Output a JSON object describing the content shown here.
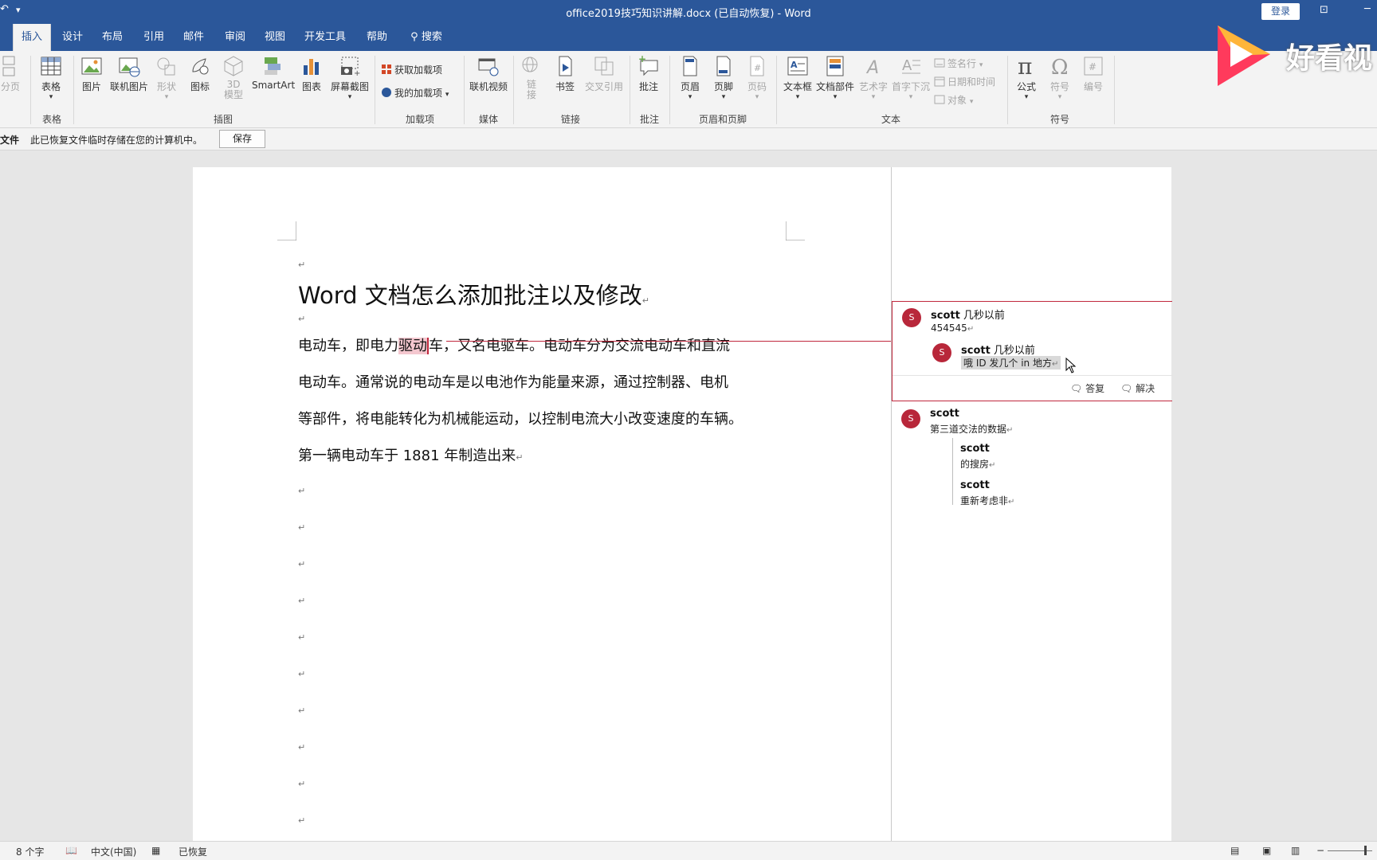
{
  "titlebar": {
    "title": "office2019技巧知识讲解.docx (已自动恢复)  -  Word",
    "login": "登录",
    "qa_icon": "undo-icon",
    "qa_dropdown": "▾"
  },
  "tabs": [
    "插入",
    "设计",
    "布局",
    "引用",
    "邮件",
    "审阅",
    "视图",
    "开发工具",
    "帮助",
    "搜索"
  ],
  "ribbon": {
    "page_break": "分页",
    "table": "表格",
    "picture": "图片",
    "online_picture": "联机图片",
    "shapes": "形状",
    "icons": "图标",
    "model3d": "3D\n模型",
    "smartart": "SmartArt",
    "chart": "图表",
    "screenshot": "屏幕截图",
    "get_addins": "获取加载项",
    "my_addins": "我的加载项",
    "online_video": "联机视频",
    "link": "链\n接",
    "bookmark": "书签",
    "cross_ref": "交叉引用",
    "comment": "批注",
    "header": "页眉",
    "footer": "页脚",
    "page_number": "页码",
    "textbox": "文本框",
    "quick_parts": "文档部件",
    "wordart": "艺术字",
    "drop_cap": "首字下沉",
    "signature": "签名行",
    "datetime": "日期和时间",
    "object": "对象",
    "equation": "公式",
    "symbol": "符号",
    "numbering": "编号",
    "groups": {
      "tables": "表格",
      "illustrations": "插图",
      "addins": "加载项",
      "media": "媒体",
      "links": "链接",
      "comments": "批注",
      "header_footer": "页眉和页脚",
      "text": "文本",
      "symbols": "符号"
    }
  },
  "infobar": {
    "label": "文件",
    "message": "此已恢复文件临时存储在您的计算机中。",
    "save": "保存"
  },
  "document": {
    "title": "Word 文档怎么添加批注以及修改",
    "line1_a": "电动车，即电力",
    "line1_hl": "驱动",
    "line1_b": "车，又名电驱车。电动车分为交流电动车和直流",
    "line2": "电动车。通常说的电动车是以电池作为能量来源，通过控制器、电机",
    "line3": "等部件，将电能转化为机械能运动，以控制电流大小改变速度的车辆。",
    "line4": "第一辆电动车于 1881 年制造出来",
    "pilcrow": "↵"
  },
  "comments": [
    {
      "author": "scott",
      "time": "几秒以前",
      "text": "454545",
      "avatar": "S",
      "replies": [
        {
          "author": "scott",
          "time": "几秒以前",
          "text": "哦 ID 发几个 in 地方",
          "avatar": "S"
        }
      ],
      "reply_label": "答复",
      "resolve_label": "解决"
    },
    {
      "author": "scott",
      "text": "第三道交法的数据",
      "avatar": "S",
      "replies": [
        {
          "author": "scott",
          "text": "的搜房"
        },
        {
          "author": "scott",
          "text": "重新考虑非"
        }
      ]
    }
  ],
  "statusbar": {
    "word_count": "8 个字",
    "language": "中文(中国)",
    "status": "已恢复"
  },
  "watermark": {
    "text": "好看视"
  },
  "colors": {
    "brand": "#2b579a",
    "avatar": "#b8273a",
    "highlight": "#f4c7cf",
    "comment_line": "#c0283d"
  }
}
